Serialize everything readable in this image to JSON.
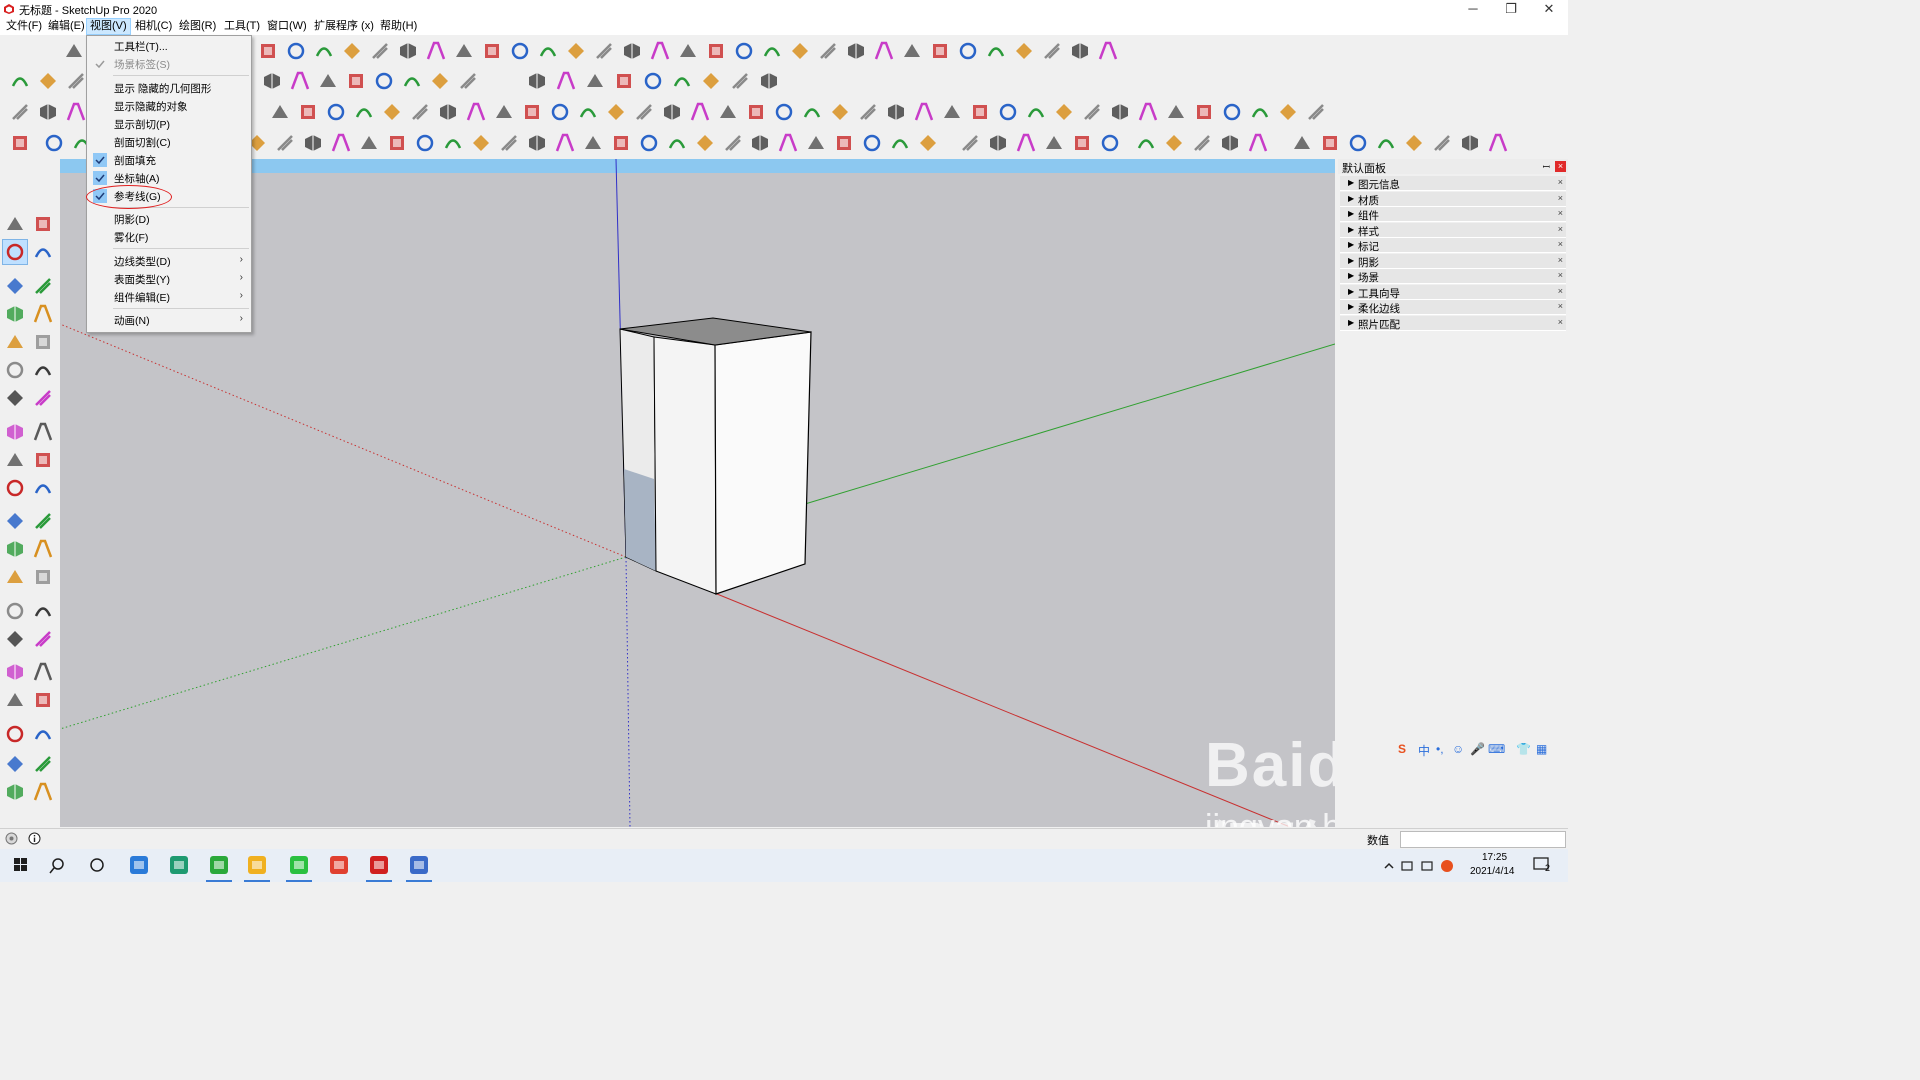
{
  "window": {
    "title": "无标题 - SketchUp Pro 2020",
    "minimize_glyph": "─",
    "restore_glyph": "❐",
    "close_glyph": "✕"
  },
  "menubar": {
    "items": [
      "文件(F)",
      "编辑(E)",
      "视图(V)",
      "相机(C)",
      "绘图(R)",
      "工具(T)",
      "窗口(W)",
      "扩展程序 (x)",
      "帮助(H)"
    ],
    "active": "视图(V)"
  },
  "view_menu": {
    "toolbars": "工具栏(T)...",
    "scene_tabs": "场景标签(S)",
    "show_hidden_geometry": "显示 隐藏的几何图形",
    "show_hidden_objects": "显示隐藏的对象",
    "show_section_planes": "显示剖切(P)",
    "section_cuts": "剖面切割(C)",
    "section_fill": "剖面填充",
    "axes": "坐标轴(A)",
    "guides": "参考线(G)",
    "shadows": "阴影(D)",
    "fog": "雾化(F)",
    "edge_style": "边线类型(D)",
    "face_style": "表面类型(Y)",
    "component_edit": "组件编辑(E)",
    "animation": "动画(N)",
    "submenu_arrow": "›",
    "checked_items": [
      "场景标签(S)",
      "剖面填充",
      "坐标轴(A)",
      "参考线(G)"
    ],
    "disabled_items": [
      "场景标签(S)"
    ],
    "highlighted_item": "参考线(G)"
  },
  "default_tray": {
    "title": "默认面板",
    "pin_glyph": "ꟷ",
    "close_glyph": "×",
    "trays": [
      "图元信息",
      "材质",
      "组件",
      "样式",
      "标记",
      "阴影",
      "场景",
      "工具向导",
      "柔化边线",
      "照片匹配"
    ],
    "tray_close": "×",
    "expander": "▶"
  },
  "statusbar": {
    "measurements_label": "数值"
  },
  "ime": {
    "logo": "S",
    "mode": "中",
    "symbols": "•,",
    "emoji": "☺",
    "mic": "🎤",
    "keyboard": "⌨",
    "skin": "👕",
    "grid": "▦"
  },
  "taskbar": {
    "time": "17:25",
    "date": "2021/4/14",
    "notification_count": "2",
    "apps": [
      "start-button",
      "search-button",
      "task-view-button",
      "pc-manager",
      "text-editor",
      "browser-360",
      "media-app",
      "wechat",
      "chrome",
      "sketchup",
      "winrar"
    ],
    "running_apps": [
      "media-app",
      "wechat",
      "sketchup",
      "winrar",
      "browser-360"
    ]
  },
  "watermark": {
    "brand": "Baidu经验",
    "url": "jingyan.baidu.com"
  },
  "colors": {
    "menu_active": "#cce8ff",
    "check_bg": "#90c8f6",
    "highlight_circle": "#e02020",
    "viewport_bg": "#c4c4c8",
    "sky": "#8cc8f0",
    "axis_red": "#c83030",
    "axis_green": "#30a030",
    "axis_blue": "#3030c8"
  }
}
